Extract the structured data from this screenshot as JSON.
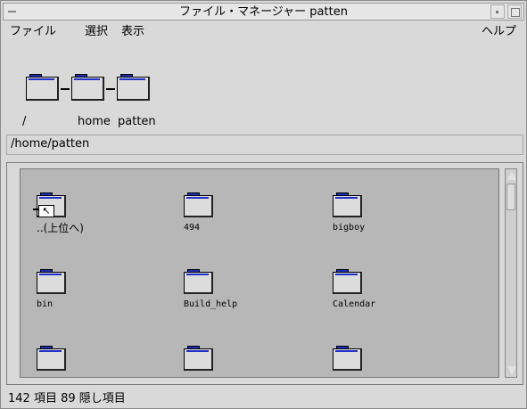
{
  "window": {
    "title": "ファイル・マネージャー patten"
  },
  "menubar": {
    "file": "ファイル",
    "select": "選択",
    "view": "表示",
    "help": "ヘルプ"
  },
  "path_icons": [
    {
      "label": "/"
    },
    {
      "label": "home"
    },
    {
      "label": "patten"
    }
  ],
  "path_field": {
    "value": "/home/patten"
  },
  "items": [
    {
      "label": "..(上位へ)",
      "icon": "parent-folder-icon"
    },
    {
      "label": "494",
      "icon": "folder-icon"
    },
    {
      "label": "bigboy",
      "icon": "folder-icon"
    },
    {
      "label": "bin",
      "icon": "folder-icon"
    },
    {
      "label": "Build_help",
      "icon": "folder-icon"
    },
    {
      "label": "Calendar",
      "icon": "folder-icon"
    },
    {
      "label": "",
      "icon": "folder-icon"
    },
    {
      "label": "",
      "icon": "folder-icon"
    },
    {
      "label": "",
      "icon": "folder-icon"
    }
  ],
  "status": {
    "text": "142 項目 89 隠し項目"
  },
  "colors": {
    "folder_tab": "#1a2eb8",
    "pane_bg": "#b7b7b7",
    "window_bg": "#d9d9d9"
  }
}
